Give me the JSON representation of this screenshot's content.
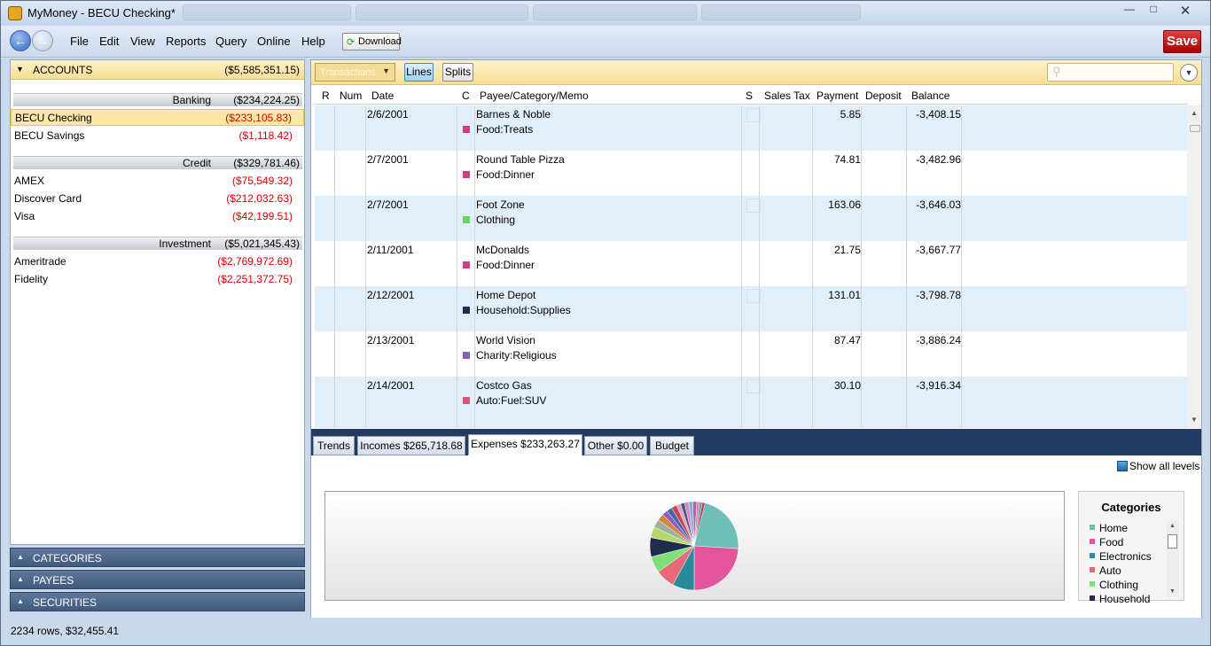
{
  "window": {
    "title": "MyMoney - BECU Checking*"
  },
  "menu": {
    "items": [
      "File",
      "Edit",
      "View",
      "Reports",
      "Query",
      "Online",
      "Help"
    ],
    "download_label": "Download",
    "save_label": "Save"
  },
  "accounts": {
    "header": "ACCOUNTS",
    "total": "($5,585,351.15)",
    "groups": [
      {
        "name": "Banking",
        "total": "($234,224.25)",
        "items": [
          {
            "name": "BECU Checking",
            "value": "($233,105.83)"
          },
          {
            "name": "BECU Savings",
            "value": "($1,118.42)"
          }
        ]
      },
      {
        "name": "Credit",
        "total": "($329,781.46)",
        "items": [
          {
            "name": "AMEX",
            "value": "($75,549.32)"
          },
          {
            "name": "Discover Card",
            "value": "($212,032.63)"
          },
          {
            "name": "Visa",
            "value": "($42,199.51)"
          }
        ]
      },
      {
        "name": "Investment",
        "total": "($5,021,345.43)",
        "items": [
          {
            "name": "Ameritrade",
            "value": "($2,769,972.69)"
          },
          {
            "name": "Fidelity",
            "value": "($2,251,372.75)"
          }
        ]
      }
    ]
  },
  "sections": [
    "CATEGORIES",
    "PAYEES",
    "SECURITIES"
  ],
  "status": "2234 rows, $32,455.41",
  "toolbar": {
    "view_select": "Transactions",
    "lines_label": "Lines",
    "splits_label": "Splits"
  },
  "grid": {
    "columns": [
      "R",
      "Num",
      "Date",
      "C",
      "Payee/Category/Memo",
      "S",
      "Sales Tax",
      "Payment",
      "Deposit",
      "Balance"
    ],
    "rows": [
      {
        "date": "2/6/2001",
        "payee": "Barnes & Noble",
        "category": "Food:Treats",
        "color": "#d63a86",
        "payment": "5.85",
        "balance": "-3,408.15"
      },
      {
        "date": "2/7/2001",
        "payee": "Round Table Pizza",
        "category": "Food:Dinner",
        "color": "#d63a86",
        "payment": "74.81",
        "balance": "-3,482.96"
      },
      {
        "date": "2/7/2001",
        "payee": "Foot Zone",
        "category": "Clothing",
        "color": "#5ddc5a",
        "payment": "163.06",
        "balance": "-3,646.03"
      },
      {
        "date": "2/11/2001",
        "payee": "McDonalds",
        "category": "Food:Dinner",
        "color": "#d63a86",
        "payment": "21.75",
        "balance": "-3,667.77"
      },
      {
        "date": "2/12/2001",
        "payee": "Home Depot",
        "category": "Household:Supplies",
        "color": "#1f2d4a",
        "payment": "131.01",
        "balance": "-3,798.78"
      },
      {
        "date": "2/13/2001",
        "payee": "World Vision",
        "category": "Charity:Religious",
        "color": "#8e5bc0",
        "payment": "87.47",
        "balance": "-3,886.24"
      },
      {
        "date": "2/14/2001",
        "payee": "Costco Gas",
        "category": "Auto:Fuel:SUV",
        "color": "#e2507a",
        "payment": "30.10",
        "balance": "-3,916.34"
      }
    ]
  },
  "tabs": [
    "Trends",
    "Incomes $265,718.68",
    "Expenses $233,263.27",
    "Other $0.00",
    "Budget"
  ],
  "show_all_levels": "Show all levels",
  "legend": {
    "title": "Categories",
    "items": [
      {
        "name": "Home",
        "color": "#6fbfb7"
      },
      {
        "name": "Food",
        "color": "#e2559b"
      },
      {
        "name": "Electronics",
        "color": "#2a8c9a"
      },
      {
        "name": "Auto",
        "color": "#e86a7a"
      },
      {
        "name": "Clothing",
        "color": "#7fe07a"
      },
      {
        "name": "Household",
        "color": "#1f2d4a"
      }
    ]
  }
}
